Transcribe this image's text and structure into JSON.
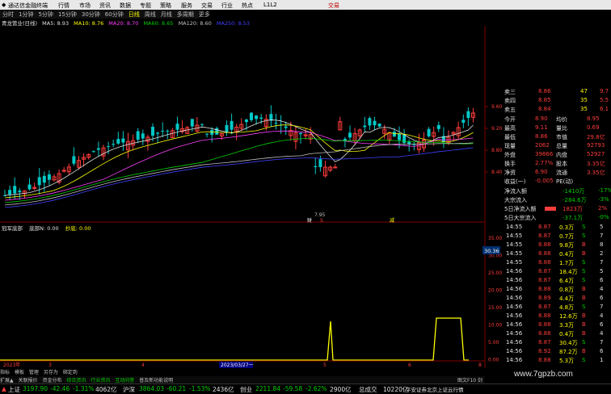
{
  "titlebar": {
    "app_name": "通达信金融终端",
    "menus": [
      "行情",
      "市场",
      "资讯",
      "数据",
      "专题",
      "策略",
      "服务",
      "交易",
      "行业",
      "热点",
      "L1L2"
    ],
    "right_link": "交易"
  },
  "periods": [
    {
      "label": "分时",
      "active": false
    },
    {
      "label": "1分钟",
      "active": false
    },
    {
      "label": "5分钟",
      "active": false
    },
    {
      "label": "15分钟",
      "active": false
    },
    {
      "label": "30分钟",
      "active": false
    },
    {
      "label": "60分钟",
      "active": false
    },
    {
      "label": "日线",
      "active": true
    },
    {
      "label": "周线",
      "active": false
    },
    {
      "label": "月线",
      "active": false
    },
    {
      "label": "多周期",
      "active": false
    },
    {
      "label": "更多",
      "active": false
    }
  ],
  "ma_legend": {
    "stock": "青龙管业(日线)",
    "items": [
      {
        "text": "MA5: 8.93",
        "color": "#e0e0e0"
      },
      {
        "text": "MA10: 8.76",
        "color": "#ffff00"
      },
      {
        "text": "MA20: 8.70",
        "color": "#ff40ff"
      },
      {
        "text": "MA60: 8.65",
        "color": "#00d000"
      },
      {
        "text": "MA120: 8.60",
        "color": "#c0c0c0"
      },
      {
        "text": "MA250: 8.53",
        "color": "#4040ff"
      }
    ]
  },
  "chart_data": {
    "type": "candlestick",
    "low_label": "7.95",
    "y_ticks": [
      "9.60",
      "9.20",
      "8.80",
      "8.40"
    ],
    "lower_ticks": [
      "35.00",
      "30.00",
      "25.00",
      "20.00",
      "15.00",
      "10.00",
      "5.00",
      "0.00"
    ],
    "lower_value": "30.36",
    "x_labels": [
      "2023年",
      "3",
      "4",
      "2023/03/27一",
      "5",
      "6",
      "8"
    ],
    "markers": [
      {
        "text": "财",
        "color": "#ffffff"
      },
      {
        "text": "S",
        "color": "#ff3c3c"
      },
      {
        "text": "减",
        "color": "#ffff00"
      }
    ]
  },
  "indicator": {
    "name": "冠军底部",
    "label1": "底部N: 0.00",
    "label2": "抄底: 0.00"
  },
  "quote_panel": {
    "asks": [
      {
        "label": "卖三",
        "price": "8.86",
        "vol": "47",
        "chg": "9.7"
      },
      {
        "label": "卖四",
        "price": "8.85",
        "vol": "35",
        "chg": "5.5"
      },
      {
        "label": "卖五",
        "price": "8.84",
        "vol": "35",
        "chg": "6.1"
      }
    ],
    "stats": [
      {
        "l1": "今开",
        "v1": "8.90",
        "l2": "均价",
        "v2": "8.95"
      },
      {
        "l1": "最高",
        "v1": "9.11",
        "l2": "量比",
        "v2": "0.69"
      },
      {
        "l1": "最低",
        "v1": "8.86",
        "l2": "市值",
        "v2": "29.8亿"
      },
      {
        "l1": "现量",
        "v1": "2062",
        "l2": "总量",
        "v2": "92793"
      },
      {
        "l1": "外盘",
        "v1": "39866",
        "l2": "内盘",
        "v2": "52927"
      },
      {
        "l1": "换手",
        "v1": "2.77%",
        "l2": "股本",
        "v2": "3.35亿"
      },
      {
        "l1": "净资",
        "v1": "6.90",
        "l2": "流通",
        "v2": "3.35亿"
      },
      {
        "l1": "收益(一)",
        "v1": "-0.005",
        "l2": "PE(动)",
        "v2": ""
      }
    ],
    "flows": [
      {
        "label": "净流入额",
        "value": "-1410万",
        "pct": "-17%"
      },
      {
        "label": "大宗流入",
        "value": "-284.6万",
        "pct": "-3%"
      },
      {
        "label": "5日净流入额",
        "value": "1823万",
        "pct": "2%"
      },
      {
        "label": "5日大宗流入",
        "value": "-37.1万",
        "pct": "-0%"
      }
    ],
    "ticks": [
      {
        "time": "14:55",
        "price": "8.87",
        "vol": "0.3万",
        "side": "S",
        "side_color": "#00d000",
        "n": "5"
      },
      {
        "time": "14:55",
        "price": "8.87",
        "vol": "0.7万",
        "side": "S",
        "side_color": "#00d000",
        "n": "7"
      },
      {
        "time": "14:55",
        "price": "8.88",
        "vol": "9.8万",
        "side": "B",
        "side_color": "#ff3c3c",
        "n": "8"
      },
      {
        "time": "14:55",
        "price": "8.88",
        "vol": "0.4万",
        "side": "B",
        "side_color": "#ff3c3c",
        "n": "2"
      },
      {
        "time": "14:55",
        "price": "8.88",
        "vol": "1.7万",
        "side": "S",
        "side_color": "#00d000",
        "n": "7"
      },
      {
        "time": "14:56",
        "price": "8.87",
        "vol": "18.4万",
        "side": "S",
        "side_color": "#00d000",
        "n": "5"
      },
      {
        "time": "14:56",
        "price": "8.87",
        "vol": "6.4万",
        "side": "S",
        "side_color": "#00d000",
        "n": "6"
      },
      {
        "time": "14:56",
        "price": "8.88",
        "vol": "0.8万",
        "side": "B",
        "side_color": "#ff3c3c",
        "n": "4"
      },
      {
        "time": "14:56",
        "price": "8.89",
        "vol": "4.4万",
        "side": "B",
        "side_color": "#ff3c3c",
        "n": "6"
      },
      {
        "time": "14:56",
        "price": "8.87",
        "vol": "4.8万",
        "side": "S",
        "side_color": "#00d000",
        "n": "7"
      },
      {
        "time": "14:56",
        "price": "8.88",
        "vol": "12.6万",
        "side": "B",
        "side_color": "#ff3c3c",
        "n": "4"
      },
      {
        "time": "14:56",
        "price": "8.88",
        "vol": "3.3万",
        "side": "B",
        "side_color": "#ff3c3c",
        "n": "6"
      },
      {
        "time": "14:56",
        "price": "8.88",
        "vol": "0.4万",
        "side": "B",
        "side_color": "#ff3c3c",
        "n": "4"
      },
      {
        "time": "14:56",
        "price": "8.87",
        "vol": "30.4万",
        "side": "S",
        "side_color": "#00d000",
        "n": "7"
      },
      {
        "time": "14:56",
        "price": "8.92",
        "vol": "87.2万",
        "side": "B",
        "side_color": "#ff3c3c",
        "n": "6"
      },
      {
        "time": "14:56",
        "price": "8.88",
        "vol": "5.3万",
        "side": "S",
        "side_color": "#00d000",
        "n": "1"
      }
    ]
  },
  "bottom_tabs": [
    "指标",
    "模板",
    "管理",
    "另存为",
    "绑定到"
  ],
  "toolbar2": [
    "扩展▲",
    "关联报价",
    "资金分布",
    "综合资讯",
    "行业资讯",
    "互动问答",
    "普及新功能说明"
  ],
  "status_bar": {
    "sh_name": "上证",
    "sh_val": "3197.90",
    "sh_chg": "-42.46",
    "sh_pct": "-1.31%",
    "sh_amt": "4062亿",
    "hs_name": "沪深",
    "hs_val": "3864.03",
    "hs_chg": "-60.21",
    "hs_pct": "-1.53%",
    "hs_amt": "2436亿",
    "cy_name": "创业",
    "cy_val": "2211.84",
    "cy_chg": "-59.58",
    "cy_pct": "-2.62%",
    "cy_amt": "2900亿",
    "total_label": "总成交",
    "total_val": "10220亿",
    "news": "平安证券北京上证云行情"
  },
  "watermark": "www.7gpzb.com",
  "right_hint": "图文F10 剑"
}
